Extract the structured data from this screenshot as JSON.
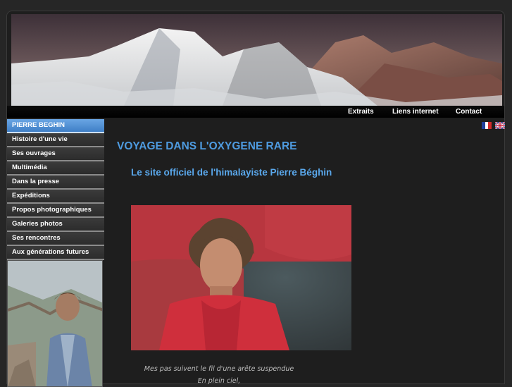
{
  "topnav": {
    "items": [
      {
        "label": "Extraits"
      },
      {
        "label": "Liens internet"
      },
      {
        "label": "Contact"
      }
    ]
  },
  "sidebar": {
    "items": [
      {
        "label": "PIERRE BEGHIN",
        "active": true
      },
      {
        "label": "Histoire d'une vie"
      },
      {
        "label": "Ses ouvrages"
      },
      {
        "label": "Multimédia"
      },
      {
        "label": "Dans la presse"
      },
      {
        "label": "Expéditions"
      },
      {
        "label": "Propos photographiques"
      },
      {
        "label": "Galeries photos"
      },
      {
        "label": "Ses rencontres"
      },
      {
        "label": "Aux générations futures"
      }
    ]
  },
  "languages": [
    "french-flag-icon",
    "uk-flag-icon"
  ],
  "main": {
    "title": "VOYAGE DANS L'OXYGENE RARE",
    "subtitle": "Le site officiel de l'himalayiste Pierre Béghin",
    "poem": [
      "Mes pas suivent le fil d'une arête suspendue",
      "En plein ciel,"
    ]
  },
  "colors": {
    "background": "#262626",
    "title_blue": "#4e9be0",
    "active_menu": "#5a9be0"
  }
}
